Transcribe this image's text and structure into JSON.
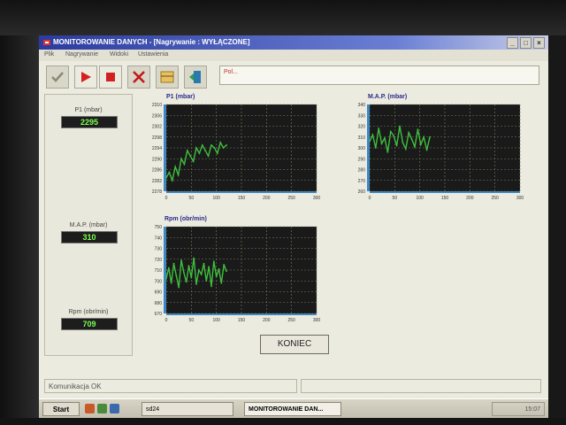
{
  "window": {
    "title": "MONITOROWANIE DANYCH - [Nagrywanie : WYŁĄCZONE]"
  },
  "menu": {
    "items": [
      "Plik",
      "Nagrywanie",
      "Widoki",
      "Ustawienia"
    ]
  },
  "toolbar": {
    "message": "Pol..."
  },
  "values": {
    "p1": {
      "label": "P1 (mbar)",
      "value": "2295"
    },
    "map": {
      "label": "M.A.P. (mbar)",
      "value": "310"
    },
    "rpm": {
      "label": "Rpm (obr/min)",
      "value": "709"
    }
  },
  "chart_data": [
    {
      "type": "line",
      "title": "P1 (mbar)",
      "y_ticks": [
        "2310",
        "2306",
        "2302",
        "2298",
        "2294",
        "2290",
        "2286",
        "2282",
        "2278"
      ],
      "x_ticks": [
        "0",
        "50",
        "100",
        "150",
        "200",
        "250",
        "300"
      ],
      "ylim": [
        2278,
        2310
      ],
      "xlim": [
        0,
        300
      ],
      "x": [
        0,
        6,
        12,
        18,
        24,
        30,
        36,
        42,
        48,
        54,
        60,
        66,
        72,
        78,
        84,
        90,
        96,
        102,
        108,
        114,
        120
      ],
      "values": [
        2283,
        2285,
        2282,
        2287,
        2284,
        2290,
        2288,
        2293,
        2291,
        2289,
        2294,
        2292,
        2295,
        2293,
        2291,
        2295,
        2294,
        2292,
        2296,
        2294,
        2295
      ],
      "color": "#3fbf3f"
    },
    {
      "type": "line",
      "title": "M.A.P. (mbar)",
      "y_ticks": [
        "340",
        "330",
        "320",
        "310",
        "300",
        "290",
        "280",
        "270",
        "260"
      ],
      "x_ticks": [
        "0",
        "50",
        "100",
        "150",
        "200",
        "250",
        "300"
      ],
      "ylim": [
        260,
        340
      ],
      "xlim": [
        0,
        300
      ],
      "x": [
        0,
        6,
        12,
        18,
        24,
        30,
        36,
        42,
        48,
        54,
        60,
        66,
        72,
        78,
        84,
        90,
        96,
        102,
        108,
        114,
        120
      ],
      "values": [
        306,
        312,
        300,
        318,
        304,
        309,
        296,
        315,
        311,
        302,
        320,
        305,
        299,
        314,
        308,
        301,
        317,
        303,
        310,
        298,
        310
      ],
      "color": "#3fbf3f"
    },
    {
      "type": "line",
      "title": "Rpm (obr/min)",
      "y_ticks": [
        "750",
        "740",
        "730",
        "720",
        "710",
        "700",
        "690",
        "680",
        "670"
      ],
      "x_ticks": [
        "0",
        "50",
        "100",
        "150",
        "200",
        "250",
        "300"
      ],
      "ylim": [
        670,
        750
      ],
      "xlim": [
        0,
        300
      ],
      "x": [
        0,
        5,
        10,
        15,
        20,
        25,
        30,
        35,
        40,
        45,
        50,
        55,
        60,
        65,
        70,
        75,
        80,
        85,
        90,
        95,
        100,
        105,
        110,
        115,
        120
      ],
      "values": [
        702,
        712,
        698,
        716,
        705,
        694,
        719,
        708,
        699,
        714,
        703,
        721,
        697,
        710,
        706,
        716,
        700,
        713,
        695,
        718,
        704,
        711,
        698,
        715,
        709
      ],
      "color": "#3fbf3f"
    }
  ],
  "buttons": {
    "end": "KONIEC"
  },
  "status": {
    "left": "Komunikacja OK"
  },
  "taskbar": {
    "start": "Start",
    "tasks": [
      "sd24",
      "MONITOROWANIE DAN..."
    ],
    "clock": "15:07"
  },
  "colors": {
    "plot_bg": "#1a1a1a",
    "trace": "#3fbf3f",
    "grid": "#7a7a5a",
    "axis": "#3a88c8"
  }
}
